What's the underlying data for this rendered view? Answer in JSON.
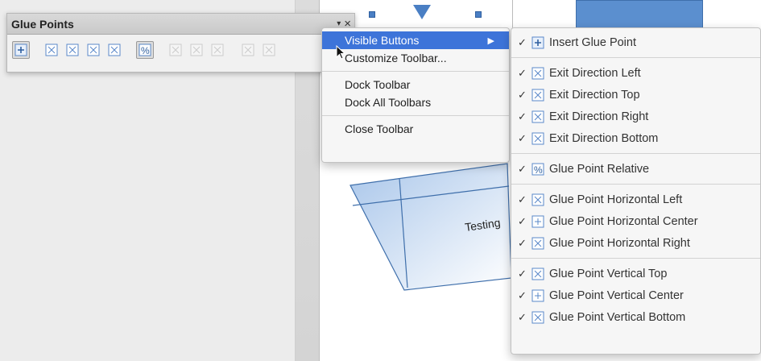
{
  "toolbar": {
    "title": "Glue Points",
    "menu_arrow": "▾",
    "close": "×",
    "buttons": [
      {
        "name": "insert-glue-point-button",
        "icon": "insert-glue-point-icon",
        "pressed": true
      },
      {
        "name": "exit-direction-left-button",
        "icon": "exit-left-icon"
      },
      {
        "name": "exit-direction-top-button",
        "icon": "exit-top-icon"
      },
      {
        "name": "exit-direction-right-button",
        "icon": "exit-right-icon"
      },
      {
        "name": "exit-direction-bottom-button",
        "icon": "exit-bottom-icon"
      },
      {
        "name": "glue-point-relative-button",
        "icon": "percent-icon",
        "pressed": true
      },
      {
        "name": "glue-horizontal-left-button",
        "icon": "horizontal-left-icon",
        "disabled": true
      },
      {
        "name": "glue-horizontal-center-button",
        "icon": "horizontal-center-icon",
        "disabled": true
      },
      {
        "name": "glue-horizontal-right-button",
        "icon": "horizontal-right-icon",
        "disabled": true
      },
      {
        "name": "glue-vertical-top-button",
        "icon": "vertical-top-icon",
        "disabled": true
      },
      {
        "name": "glue-vertical-center-button",
        "icon": "vertical-center-icon",
        "disabled": true
      }
    ]
  },
  "context_menu": {
    "visible_buttons": "Visible Buttons",
    "submenu_arrow": "▶",
    "customize": "Customize Toolbar...",
    "dock": "Dock Toolbar",
    "dock_all": "Dock All Toolbars",
    "close": "Close Toolbar"
  },
  "submenu": {
    "check": "✓",
    "items": [
      "Insert Glue Point",
      "Exit Direction Left",
      "Exit Direction Top",
      "Exit Direction Right",
      "Exit Direction Bottom",
      "Glue Point Relative",
      "Glue Point Horizontal Left",
      "Glue Point Horizontal Center",
      "Glue Point Horizontal Right",
      "Glue Point Vertical Top",
      "Glue Point Vertical Center",
      "Glue Point Vertical Bottom"
    ]
  },
  "canvas": {
    "shape_text": "Testing"
  },
  "colors": {
    "accent": "#3d74d9",
    "shape_fill": "#c9dcf3",
    "shape_stroke": "#3f6fab",
    "icon_blue": "#5a88c9"
  }
}
